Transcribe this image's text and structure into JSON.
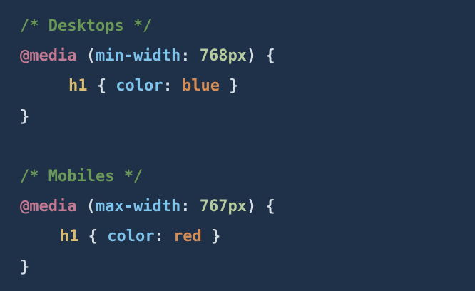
{
  "colors": {
    "background": "#1f3049",
    "comment": "#6b9a57",
    "at_rule": "#c27a92",
    "punctuation": "#d3dbe3",
    "property": "#7ec3ea",
    "number": "#b7cc9c",
    "selector": "#dcbc72",
    "value": "#d58c55"
  },
  "lines": [
    {
      "indent": 0,
      "tokens": [
        {
          "t": "/* Desktops */",
          "k": "comment"
        }
      ]
    },
    {
      "indent": 0,
      "tokens": [
        {
          "t": "@media",
          "k": "at_rule"
        },
        {
          "t": " (",
          "k": "punctuation"
        },
        {
          "t": "min-width",
          "k": "property"
        },
        {
          "t": ": ",
          "k": "punctuation"
        },
        {
          "t": "768px",
          "k": "number"
        },
        {
          "t": ") {",
          "k": "punctuation"
        }
      ]
    },
    {
      "indent": 1,
      "tokens": [
        {
          "t": "h1",
          "k": "selector"
        },
        {
          "t": " { ",
          "k": "punctuation"
        },
        {
          "t": "color",
          "k": "property"
        },
        {
          "t": ": ",
          "k": "punctuation"
        },
        {
          "t": "blue",
          "k": "value"
        },
        {
          "t": " }",
          "k": "punctuation"
        }
      ]
    },
    {
      "indent": 0,
      "tokens": [
        {
          "t": "}",
          "k": "punctuation"
        }
      ]
    },
    {
      "indent": 0,
      "tokens": []
    },
    {
      "indent": 0,
      "tokens": [
        {
          "t": "/* Mobiles */",
          "k": "comment"
        }
      ]
    },
    {
      "indent": 0,
      "tokens": [
        {
          "t": "@media",
          "k": "at_rule"
        },
        {
          "t": " (",
          "k": "punctuation"
        },
        {
          "t": "max-width",
          "k": "property"
        },
        {
          "t": ": ",
          "k": "punctuation"
        },
        {
          "t": "767px",
          "k": "number"
        },
        {
          "t": ") {",
          "k": "punctuation"
        }
      ]
    },
    {
      "indent": 2,
      "tokens": [
        {
          "t": "h1",
          "k": "selector"
        },
        {
          "t": " { ",
          "k": "punctuation"
        },
        {
          "t": "color",
          "k": "property"
        },
        {
          "t": ": ",
          "k": "punctuation"
        },
        {
          "t": "red",
          "k": "value"
        },
        {
          "t": " }",
          "k": "punctuation"
        }
      ]
    },
    {
      "indent": 0,
      "tokens": [
        {
          "t": "}",
          "k": "punctuation"
        }
      ]
    }
  ]
}
